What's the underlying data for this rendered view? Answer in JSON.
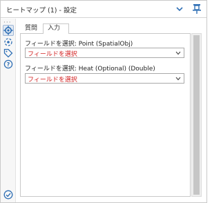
{
  "window": {
    "title": "ヒートマップ (1) - 設定",
    "icons": [
      "chevron-down-icon",
      "pin-icon"
    ]
  },
  "rail": {
    "dots": "···",
    "items": [
      {
        "name": "config-icon",
        "active": true
      },
      {
        "name": "connection-icon",
        "active": false
      },
      {
        "name": "tag-icon",
        "active": false
      },
      {
        "name": "help-icon",
        "active": false
      }
    ],
    "status_icon": "check-circle-icon"
  },
  "tabs": [
    {
      "label": "質問"
    },
    {
      "label": "入力"
    }
  ],
  "form": {
    "field1_label": "フィールドを選択: Point (SpatialObj)",
    "field1_value": "フィールドを選択",
    "field2_label": "フィールドを選択: Heat (Optional) (Double)",
    "field2_value": "フィールドを選択"
  },
  "colors": {
    "accent": "#2f6fb5",
    "placeholder_red": "#d21e1e"
  }
}
